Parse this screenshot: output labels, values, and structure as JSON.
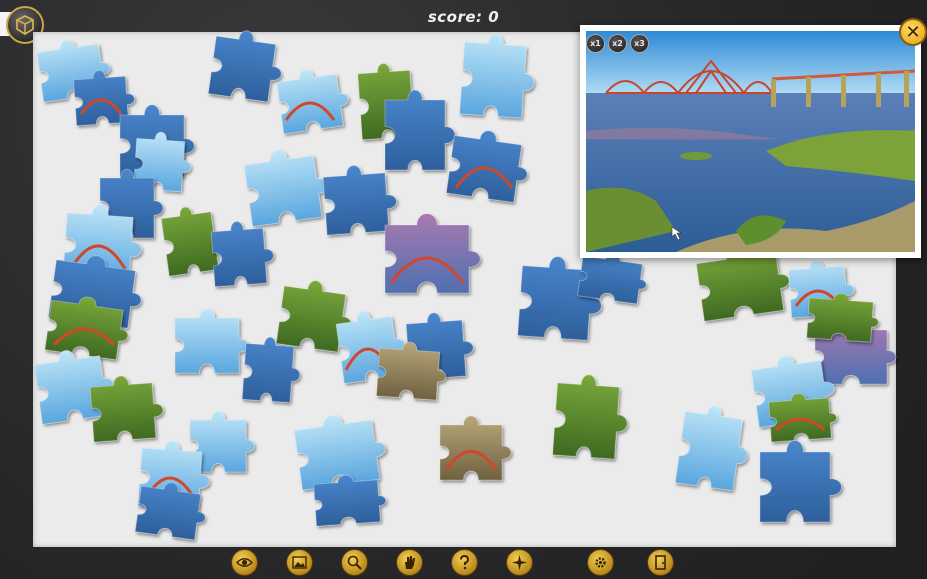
{
  "score": {
    "text": "score: 0"
  },
  "preview": {
    "zoom_buttons": [
      "x1",
      "x2",
      "x3"
    ],
    "close_label": "✕"
  },
  "toolbar": {
    "tools": [
      {
        "name": "show-preview",
        "icon": "eye-icon"
      },
      {
        "name": "show-image",
        "icon": "picture-icon"
      },
      {
        "name": "find-piece",
        "icon": "magnifier-icon"
      },
      {
        "name": "sort-pieces",
        "icon": "hand-icon"
      },
      {
        "name": "hint",
        "icon": "question-icon"
      },
      {
        "name": "magic",
        "icon": "sparkle-icon"
      },
      {
        "name": "settings",
        "icon": "gear-icon"
      },
      {
        "name": "exit",
        "icon": "door-icon"
      }
    ]
  },
  "colors": {
    "board": "#ebebeb",
    "frame": "#2a2a2c",
    "accent": "#e3a418",
    "water": "#3c7cc4",
    "sky": "#9cd3f2",
    "bridge": "#d0482a",
    "moss": "#5f8a2a"
  }
}
